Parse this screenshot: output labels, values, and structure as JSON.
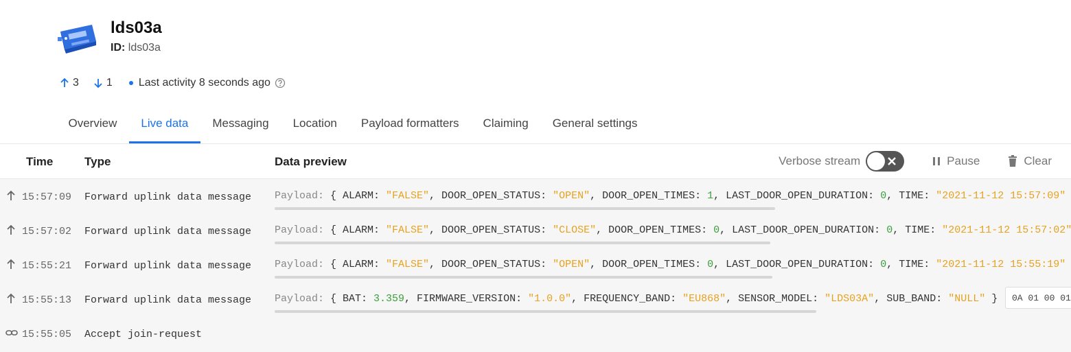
{
  "device": {
    "title": "lds03a",
    "id_label": "ID:",
    "id_value": "lds03a"
  },
  "stats": {
    "uplink": "3",
    "downlink": "1",
    "activity_prefix": "Last activity",
    "activity_time": "8 seconds ago"
  },
  "tabs": [
    {
      "label": "Overview",
      "active": false
    },
    {
      "label": "Live data",
      "active": true
    },
    {
      "label": "Messaging",
      "active": false
    },
    {
      "label": "Location",
      "active": false
    },
    {
      "label": "Payload formatters",
      "active": false
    },
    {
      "label": "Claiming",
      "active": false
    },
    {
      "label": "General settings",
      "active": false
    }
  ],
  "table": {
    "headers": {
      "time": "Time",
      "type": "Type",
      "preview": "Data preview"
    },
    "verbose_label": "Verbose stream",
    "pause_label": "Pause",
    "clear_label": "Clear"
  },
  "events": [
    {
      "icon": "arrow-up-icon",
      "time": "15:57:09",
      "type": "Forward uplink data message",
      "payload_label": "Payload:",
      "payload": [
        [
          "p",
          "{ ALARM: "
        ],
        [
          "s",
          "\"FALSE\""
        ],
        [
          "p",
          ", DOOR_OPEN_STATUS: "
        ],
        [
          "s",
          "\"OPEN\""
        ],
        [
          "p",
          ", DOOR_OPEN_TIMES: "
        ],
        [
          "n",
          "1"
        ],
        [
          "p",
          ", LAST_DOOR_OPEN_DURATION: "
        ],
        [
          "n",
          "0"
        ],
        [
          "p",
          ", TIME: "
        ],
        [
          "s",
          "\"2021-11-12 15:57:09\""
        ]
      ],
      "raw": ""
    },
    {
      "icon": "arrow-up-icon",
      "time": "15:57:02",
      "type": "Forward uplink data message",
      "payload_label": "Payload:",
      "payload": [
        [
          "p",
          "{ ALARM: "
        ],
        [
          "s",
          "\"FALSE\""
        ],
        [
          "p",
          ", DOOR_OPEN_STATUS: "
        ],
        [
          "s",
          "\"CLOSE\""
        ],
        [
          "p",
          ", DOOR_OPEN_TIMES: "
        ],
        [
          "n",
          "0"
        ],
        [
          "p",
          ", LAST_DOOR_OPEN_DURATION: "
        ],
        [
          "n",
          "0"
        ],
        [
          "p",
          ", TIME: "
        ],
        [
          "s",
          "\"2021-11-12 15:57:02\""
        ]
      ],
      "raw": ""
    },
    {
      "icon": "arrow-up-icon",
      "time": "15:55:21",
      "type": "Forward uplink data message",
      "payload_label": "Payload:",
      "payload": [
        [
          "p",
          "{ ALARM: "
        ],
        [
          "s",
          "\"FALSE\""
        ],
        [
          "p",
          ", DOOR_OPEN_STATUS: "
        ],
        [
          "s",
          "\"OPEN\""
        ],
        [
          "p",
          ", DOOR_OPEN_TIMES: "
        ],
        [
          "n",
          "0"
        ],
        [
          "p",
          ", LAST_DOOR_OPEN_DURATION: "
        ],
        [
          "n",
          "0"
        ],
        [
          "p",
          ", TIME: "
        ],
        [
          "s",
          "\"2021-11-12 15:55:19\""
        ]
      ],
      "raw": ""
    },
    {
      "icon": "arrow-up-icon",
      "time": "15:55:13",
      "type": "Forward uplink data message",
      "payload_label": "Payload:",
      "payload": [
        [
          "p",
          "{ BAT: "
        ],
        [
          "n",
          "3.359"
        ],
        [
          "p",
          ", FIRMWARE_VERSION: "
        ],
        [
          "s",
          "\"1.0.0\""
        ],
        [
          "p",
          ", FREQUENCY_BAND: "
        ],
        [
          "s",
          "\"EU868\""
        ],
        [
          "p",
          ", SENSOR_MODEL: "
        ],
        [
          "s",
          "\"LDS03A\""
        ],
        [
          "p",
          ", SUB_BAND: "
        ],
        [
          "s",
          "\"NULL\""
        ],
        [
          "p",
          " }"
        ]
      ],
      "raw": "0A 01 00 01"
    },
    {
      "icon": "link-icon",
      "time": "15:55:05",
      "type": "Accept join-request",
      "payload_label": "",
      "payload": [],
      "raw": ""
    }
  ]
}
